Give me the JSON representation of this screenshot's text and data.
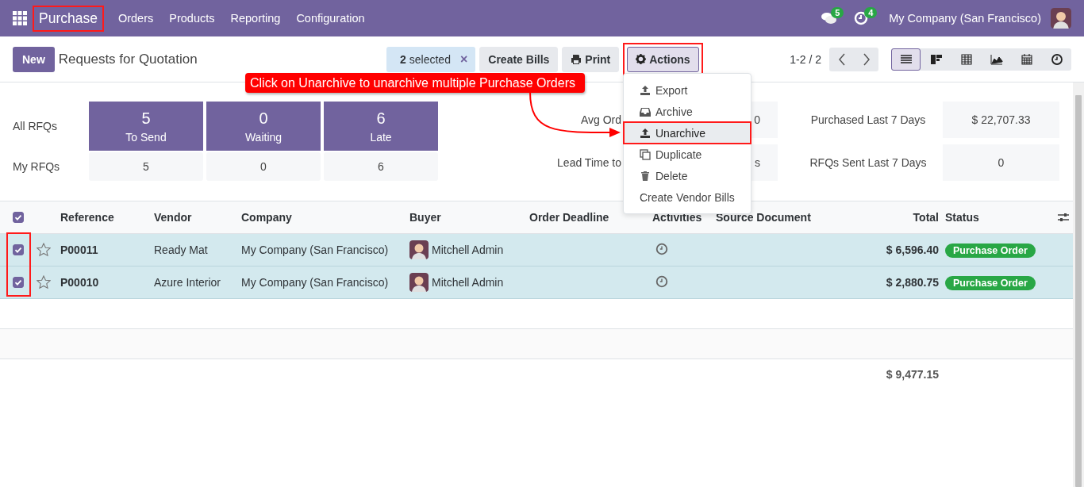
{
  "navbar": {
    "app": {
      "label": "Purchase",
      "highlighted": true
    },
    "menus": [
      "Orders",
      "Products",
      "Reporting",
      "Configuration"
    ],
    "messages_badge": "5",
    "activities_badge": "4",
    "company": "My Company (San Francisco)"
  },
  "control_panel": {
    "new_button": "New",
    "title": "Requests for Quotation",
    "selection": {
      "count": "2",
      "label": "selected",
      "clear": "×"
    },
    "buttons": [
      "Create Bills",
      "Print"
    ],
    "actions": {
      "label": "Actions",
      "open": true,
      "highlighted": true
    },
    "pager": "1-2 / 2",
    "views": [
      {
        "kind": "list",
        "selected": true
      },
      {
        "kind": "kanban",
        "selected": false
      },
      {
        "kind": "pivot",
        "selected": false
      },
      {
        "kind": "graph",
        "selected": false
      },
      {
        "kind": "calendar",
        "selected": false
      },
      {
        "kind": "activity",
        "selected": false
      }
    ]
  },
  "actions_menu": {
    "items": [
      {
        "label": "Export",
        "selected": false,
        "highlighted": false
      },
      {
        "label": "Archive",
        "selected": false,
        "highlighted": false
      },
      {
        "label": "Unarchive",
        "selected": true,
        "highlighted": true
      },
      {
        "label": "Duplicate",
        "selected": false,
        "highlighted": false
      },
      {
        "label": "Delete",
        "selected": false,
        "highlighted": false
      },
      {
        "label": "Create Vendor Bills",
        "selected": false,
        "highlighted": false
      }
    ]
  },
  "annotation": {
    "text": "Click on Unarchive to unarchive multiple Purchase Orders"
  },
  "dashboard": {
    "row_labels": [
      "All RFQs",
      "My RFQs"
    ],
    "tiles": [
      {
        "value": "5",
        "label": "To Send",
        "mine": "5"
      },
      {
        "value": "0",
        "label": "Waiting",
        "mine": "0"
      },
      {
        "value": "6",
        "label": "Late",
        "mine": "6"
      }
    ],
    "stats": [
      {
        "label": "Avg Ord",
        "value": "0"
      },
      {
        "label": "Purchased Last 7 Days",
        "value": "$ 22,707.33"
      },
      {
        "label": "Lead Time to",
        "value": "s"
      },
      {
        "label": "RFQs Sent Last 7 Days",
        "value": "0"
      }
    ]
  },
  "table": {
    "select_all_checked": true,
    "checkbox_column_highlighted": true,
    "columns": [
      "Reference",
      "Vendor",
      "Company",
      "Buyer",
      "Order Deadline",
      "Activities",
      "Source Document",
      "Total",
      "Status"
    ],
    "rows": [
      {
        "checked": true,
        "starred": false,
        "reference": "P00011",
        "vendor": "Ready Mat",
        "company": "My Company (San Francisco)",
        "buyer": "Mitchell Admin",
        "total": "$ 6,596.40",
        "status": "Purchase Order"
      },
      {
        "checked": true,
        "starred": false,
        "reference": "P00010",
        "vendor": "Azure Interior",
        "company": "My Company (San Francisco)",
        "buyer": "Mitchell Admin",
        "total": "$ 2,880.75",
        "status": "Purchase Order"
      }
    ],
    "footer_total": "$ 9,477.15"
  }
}
